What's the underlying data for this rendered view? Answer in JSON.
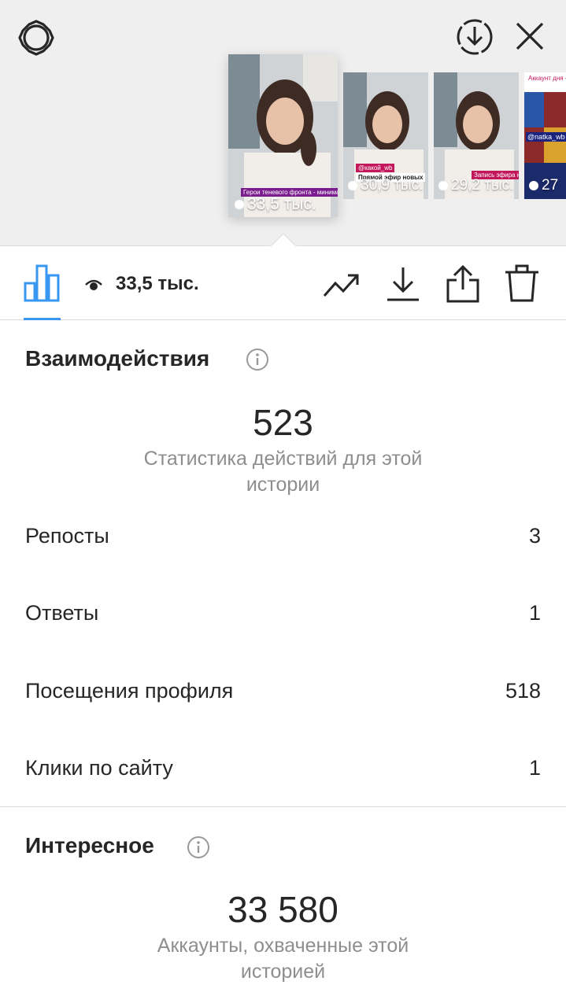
{
  "viewer": {
    "gear_icon": "gear-icon",
    "download_icon": "download-circle-icon",
    "close_icon": "close-icon",
    "thumbnails": [
      {
        "views": "33,5 тыс.",
        "caption": "Герои теневого фронта - минималисты из Instagram"
      },
      {
        "views": "30,9 тыс.",
        "caption": "@какой_wb",
        "caption2": "Прямой эфир новых"
      },
      {
        "views": "29,2 тыс.",
        "caption": "Запись эфира на канале"
      },
      {
        "views": "27",
        "caption": "Аккаунт дня — с Натальей",
        "handle": "@natka_wb"
      }
    ]
  },
  "toolbar": {
    "views_label": "33,5 тыс."
  },
  "interactions": {
    "title": "Взаимодействия",
    "total": "523",
    "subtitle_line1": "Статистика действий для этой",
    "subtitle_line2": "истории",
    "rows": [
      {
        "label": "Репосты",
        "value": "3"
      },
      {
        "label": "Ответы",
        "value": "1"
      },
      {
        "label": "Посещения профиля",
        "value": "518"
      },
      {
        "label": "Клики по сайту",
        "value": "1"
      }
    ]
  },
  "discovery": {
    "title": "Интересное",
    "total": "33 580",
    "subtitle_line1": "Аккаунты, охваченные этой",
    "subtitle_line2": "историей"
  },
  "colors": {
    "accent": "#3897f0",
    "text": "#262626",
    "muted": "#8e8e8e",
    "divider": "#dbdbdb",
    "viewer_bg": "#efefef"
  }
}
